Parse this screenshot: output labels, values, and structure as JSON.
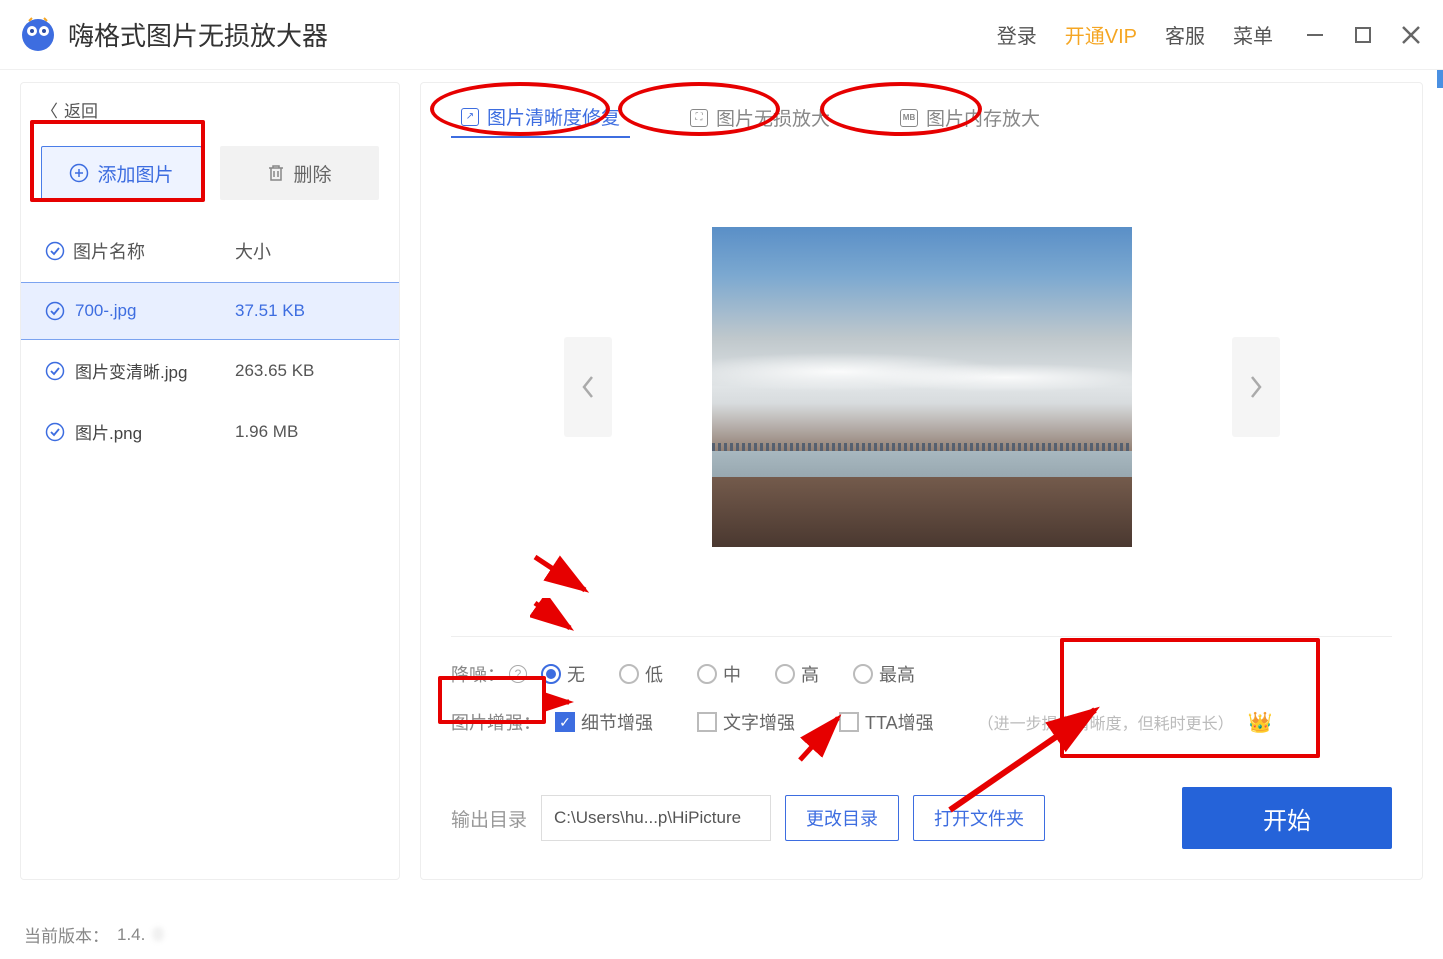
{
  "app": {
    "title": "嗨格式图片无损放大器"
  },
  "nav": {
    "login": "登录",
    "vip": "开通VIP",
    "support": "客服",
    "menu": "菜单"
  },
  "sidebar": {
    "back": "返回",
    "add_button": "添加图片",
    "delete_button": "删除",
    "header_name": "图片名称",
    "header_size": "大小",
    "files": [
      {
        "name": "700-.jpg",
        "size": "37.51 KB"
      },
      {
        "name": "图片变清晰.jpg",
        "size": "263.65 KB"
      },
      {
        "name": "图片.png",
        "size": "1.96 MB"
      }
    ]
  },
  "tabs": [
    {
      "label": "图片清晰度修复"
    },
    {
      "label": "图片无损放大"
    },
    {
      "label": "图片内存放大"
    }
  ],
  "denoise": {
    "label": "降噪：",
    "options": [
      "无",
      "低",
      "中",
      "高",
      "最高"
    ]
  },
  "enhance": {
    "label": "图片增强：",
    "detail": "细节增强",
    "text": "文字增强",
    "tta": "TTA增强",
    "hint": "（进一步提升清晰度，但耗时更长）"
  },
  "output": {
    "label": "输出目录",
    "path": "C:\\Users\\hu...p\\HiPicture",
    "change": "更改目录",
    "open": "打开文件夹",
    "start": "开始"
  },
  "footer": {
    "version_label": "当前版本：",
    "version": "1.4."
  }
}
